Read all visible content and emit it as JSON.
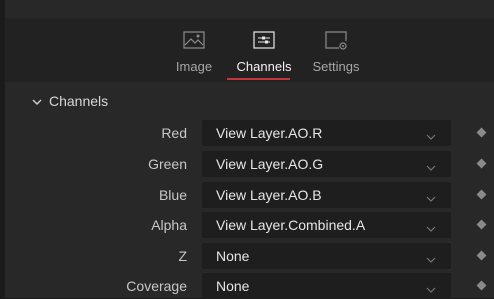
{
  "tabs": [
    {
      "label": "Image",
      "icon": "image-icon",
      "active": false
    },
    {
      "label": "Channels",
      "icon": "sliders-icon",
      "active": true
    },
    {
      "label": "Settings",
      "icon": "settings-gear-icon",
      "active": false
    }
  ],
  "section": {
    "title": "Channels",
    "icon": "chevron-down-icon"
  },
  "rows": [
    {
      "label": "Red",
      "value": "View Layer.AO.R"
    },
    {
      "label": "Green",
      "value": "View Layer.AO.G"
    },
    {
      "label": "Blue",
      "value": "View Layer.AO.B"
    },
    {
      "label": "Alpha",
      "value": "View Layer.Combined.A"
    },
    {
      "label": "Z",
      "value": "None"
    },
    {
      "label": "Coverage",
      "value": "None"
    }
  ],
  "colors": {
    "accent": "#c5353c",
    "panel": "#282828",
    "dropdown": "#1e1e1e"
  }
}
